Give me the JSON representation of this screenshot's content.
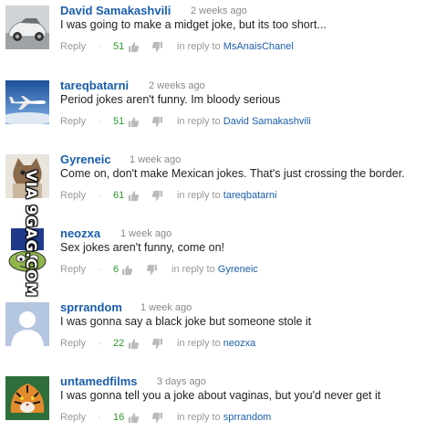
{
  "comments": [
    {
      "author": "David Samakashvili",
      "time": "2 weeks ago",
      "text": "I was going to make a midget joke, but its too short...",
      "reply_label": "Reply",
      "likes": "51",
      "in_reply_prefix": "in reply to",
      "in_reply_to": "MsAnaisChanel",
      "avatar_icon": "car-avatar"
    },
    {
      "author": "tareqbatarni",
      "time": "2 weeks ago",
      "text": "Period jokes aren't funny. Im bloody serious",
      "reply_label": "Reply",
      "likes": "51",
      "in_reply_prefix": "in reply to",
      "in_reply_to": "David Samakashvili",
      "avatar_icon": "airplane-avatar"
    },
    {
      "author": "Gyreneic",
      "time": "1 week ago",
      "text": "Come on, don't make Mexican jokes. That's just crossing the border.",
      "reply_label": "Reply",
      "likes": "61",
      "in_reply_prefix": "in reply to",
      "in_reply_to": "tareqbatarni",
      "avatar_icon": "cat-avatar"
    },
    {
      "author": "neozxa",
      "time": "1 week ago",
      "text": "Sex jokes aren't funny, come on!",
      "reply_label": "Reply",
      "likes": "6",
      "in_reply_prefix": "in reply to",
      "in_reply_to": "Gyreneic",
      "avatar_icon": "cartoon-face-avatar"
    },
    {
      "author": "sprrandom",
      "time": "1 week ago",
      "text": "I was gonna say a black joke but someone stole it",
      "reply_label": "Reply",
      "likes": "22",
      "in_reply_prefix": "in reply to",
      "in_reply_to": "neozxa",
      "avatar_icon": "default-user-avatar"
    },
    {
      "author": "untamedfilms",
      "time": "3 days ago",
      "text": "I was gonna tell you a joke about vaginas, but you'd never get it",
      "reply_label": "Reply",
      "likes": "16",
      "in_reply_prefix": "in reply to",
      "in_reply_to": "sprrandom",
      "avatar_icon": "tiger-avatar"
    }
  ],
  "watermark": "VIA 9GAG.COM",
  "colors": {
    "author_link": "#1a5eab",
    "likes_green": "#2d9a2d",
    "muted_text": "#999999"
  }
}
